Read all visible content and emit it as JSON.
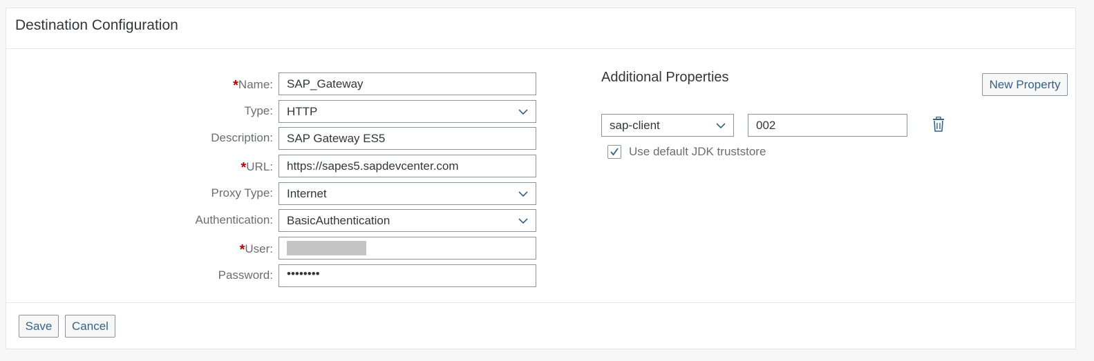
{
  "panel": {
    "title": "Destination Configuration"
  },
  "form": {
    "name": {
      "label": "Name:",
      "value": "SAP_Gateway"
    },
    "type": {
      "label": "Type:",
      "value": "HTTP"
    },
    "description": {
      "label": "Description:",
      "value": "SAP Gateway ES5"
    },
    "url": {
      "label": "URL:",
      "value": "https://sapes5.sapdevcenter.com"
    },
    "proxy_type": {
      "label": "Proxy Type:",
      "value": "Internet"
    },
    "authentication": {
      "label": "Authentication:",
      "value": "BasicAuthentication"
    },
    "user": {
      "label": "User:"
    },
    "password": {
      "label": "Password:",
      "value": "••••••••"
    },
    "required_marker": "*"
  },
  "additional": {
    "title": "Additional Properties",
    "new_property_label": "New Property",
    "property_key": "sap-client",
    "property_value": "002",
    "truststore_label": "Use default JDK truststore",
    "truststore_checked": true
  },
  "footer": {
    "save_label": "Save",
    "cancel_label": "Cancel"
  },
  "colors": {
    "accent": "#346187",
    "required": "#bb0000",
    "border": "#89919a"
  },
  "icons": {
    "dropdown": "chevron-down-icon",
    "delete": "trash-icon",
    "check": "checkmark-icon"
  }
}
